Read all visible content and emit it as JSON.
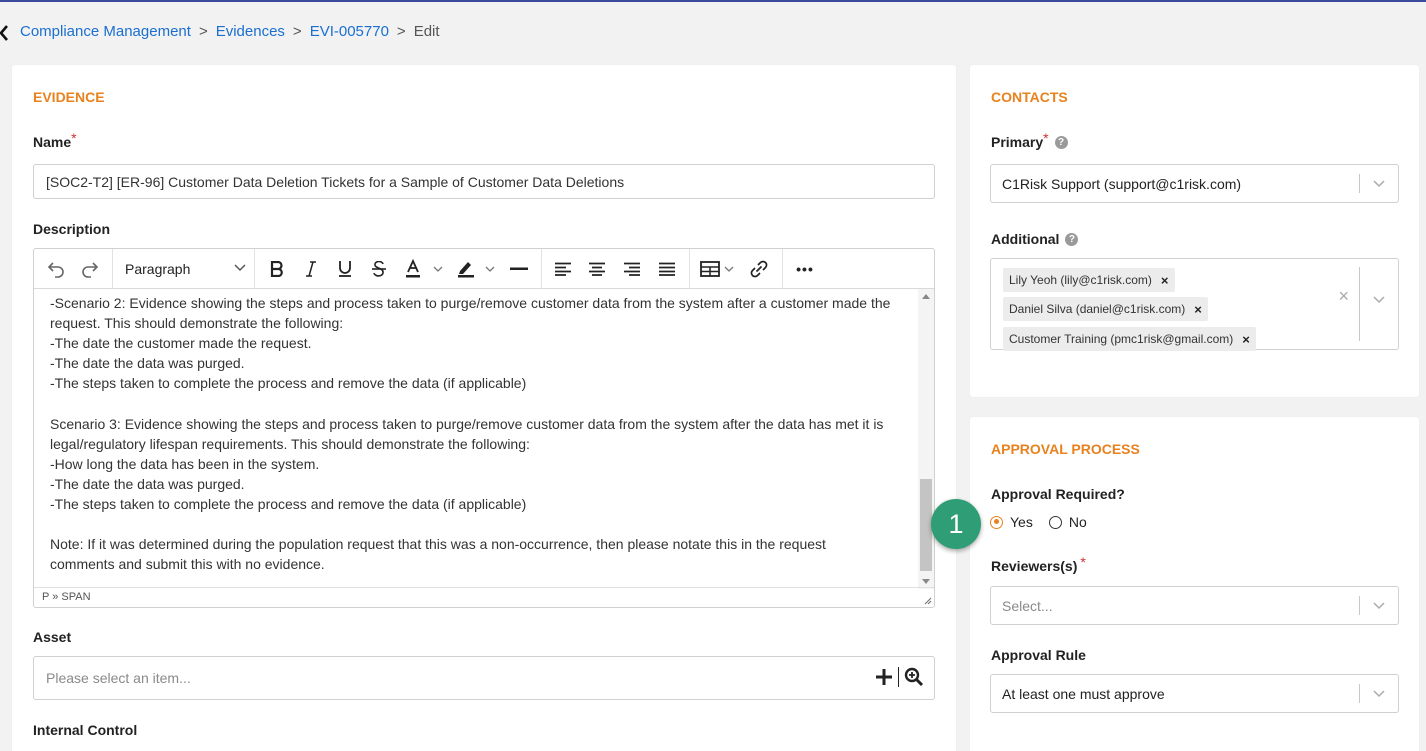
{
  "breadcrumb": {
    "items": [
      "Compliance Management",
      "Evidences",
      "EVI-005770"
    ],
    "current": "Edit",
    "separator": ">"
  },
  "evidence": {
    "section_title": "EVIDENCE",
    "name_label": "Name",
    "required_mark": "*",
    "name_value": "[SOC2-T2] [ER-96] Customer Data Deletion Tickets for a Sample of Customer Data Deletions",
    "description_label": "Description",
    "toolbar": {
      "paragraph_select": "Paragraph",
      "buttons": [
        "undo-icon",
        "redo-icon",
        "bold-icon",
        "italic-icon",
        "underline-icon",
        "strikethrough-icon",
        "text-color-icon",
        "highlight-icon",
        "horizontal-rule-icon",
        "align-left-icon",
        "align-center-icon",
        "align-right-icon",
        "justify-icon",
        "table-icon",
        "link-icon",
        "more-icon"
      ],
      "more_label": "•••"
    },
    "description_lines": [
      "-Scenario 2: Evidence showing the steps and process taken to purge/remove customer data from the system after a customer made the",
      "request. This should demonstrate the following:",
      "-The date the customer made the request.",
      "-The date the data was purged.",
      "-The steps taken to complete the process and remove the data (if applicable)",
      "",
      "Scenario 3: Evidence showing the steps and process taken to purge/remove customer data from the system after the data has met it is",
      "legal/regulatory lifespan requirements. This should demonstrate the following:",
      "-How long the data has been in the system.",
      "-The date the data was purged.",
      "-The steps taken to complete the process and remove the data (if applicable)",
      "",
      "Note: If it was determined during the population request that this was a non-occurrence, then please notate this in the request",
      "comments and submit this with no evidence."
    ],
    "editor_path": "P » SPAN",
    "asset_label": "Asset",
    "asset_placeholder": "Please select an item...",
    "internal_control_label": "Internal Control"
  },
  "contacts": {
    "section_title": "CONTACTS",
    "primary_label": "Primary",
    "primary_value": "C1Risk Support (support@c1risk.com)",
    "additional_label": "Additional",
    "additional_tags": [
      "Lily Yeoh (lily@c1risk.com)",
      "Daniel Silva (daniel@c1risk.com)",
      "Customer Training (pmc1risk@gmail.com)"
    ],
    "tag_remove": "×",
    "clear_all": "×",
    "help": "?"
  },
  "approval": {
    "section_title": "APPROVAL PROCESS",
    "approval_required_label": "Approval Required?",
    "options": [
      "Yes",
      "No"
    ],
    "selected": "Yes",
    "reviewers_label": "Reviewers(s)",
    "reviewers_placeholder": "Select...",
    "rule_label": "Approval Rule",
    "rule_value": "At least one must approve"
  },
  "annotation": {
    "step_number": "1",
    "color": "#2f9e77"
  },
  "colors": {
    "accent_orange": "#e8821e",
    "link_blue": "#1a6fd1",
    "required_red": "#d32f2f"
  }
}
